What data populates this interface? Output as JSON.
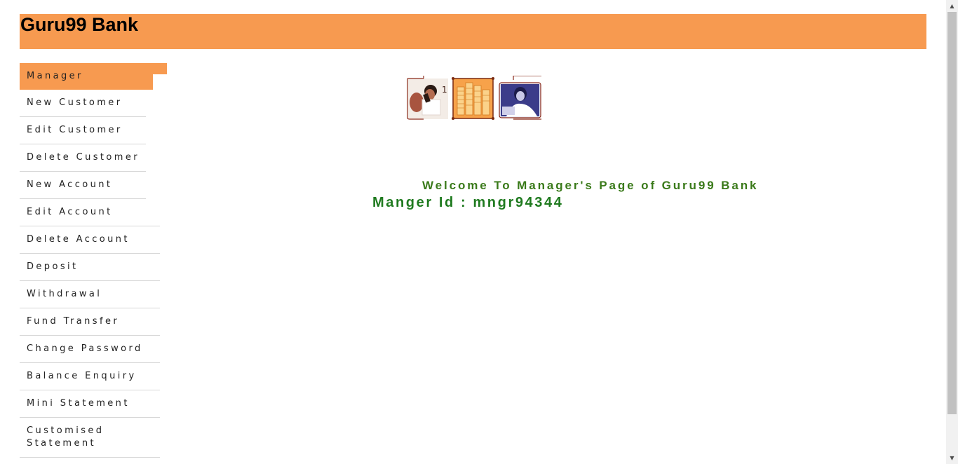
{
  "header": {
    "brand": "Guru99 Bank",
    "color": "#f79a50"
  },
  "menu": {
    "items": [
      {
        "label": "Manager",
        "active": true
      },
      {
        "label": "New Customer"
      },
      {
        "label": "Edit Customer"
      },
      {
        "label": "Delete Customer"
      },
      {
        "label": "New Account"
      },
      {
        "label": "Edit Account"
      },
      {
        "label": "Delete Account"
      },
      {
        "label": "Deposit"
      },
      {
        "label": "Withdrawal"
      },
      {
        "label": "Fund Transfer"
      },
      {
        "label": "Change Password"
      },
      {
        "label": "Balance Enquiry"
      },
      {
        "label": "Mini Statement"
      },
      {
        "label": "Customised Statement"
      }
    ]
  },
  "main": {
    "welcome": "Welcome To Manager's Page of Guru99 Bank",
    "manager_id": "Manger Id : mngr94344",
    "text_color": "#3a7a1a"
  }
}
